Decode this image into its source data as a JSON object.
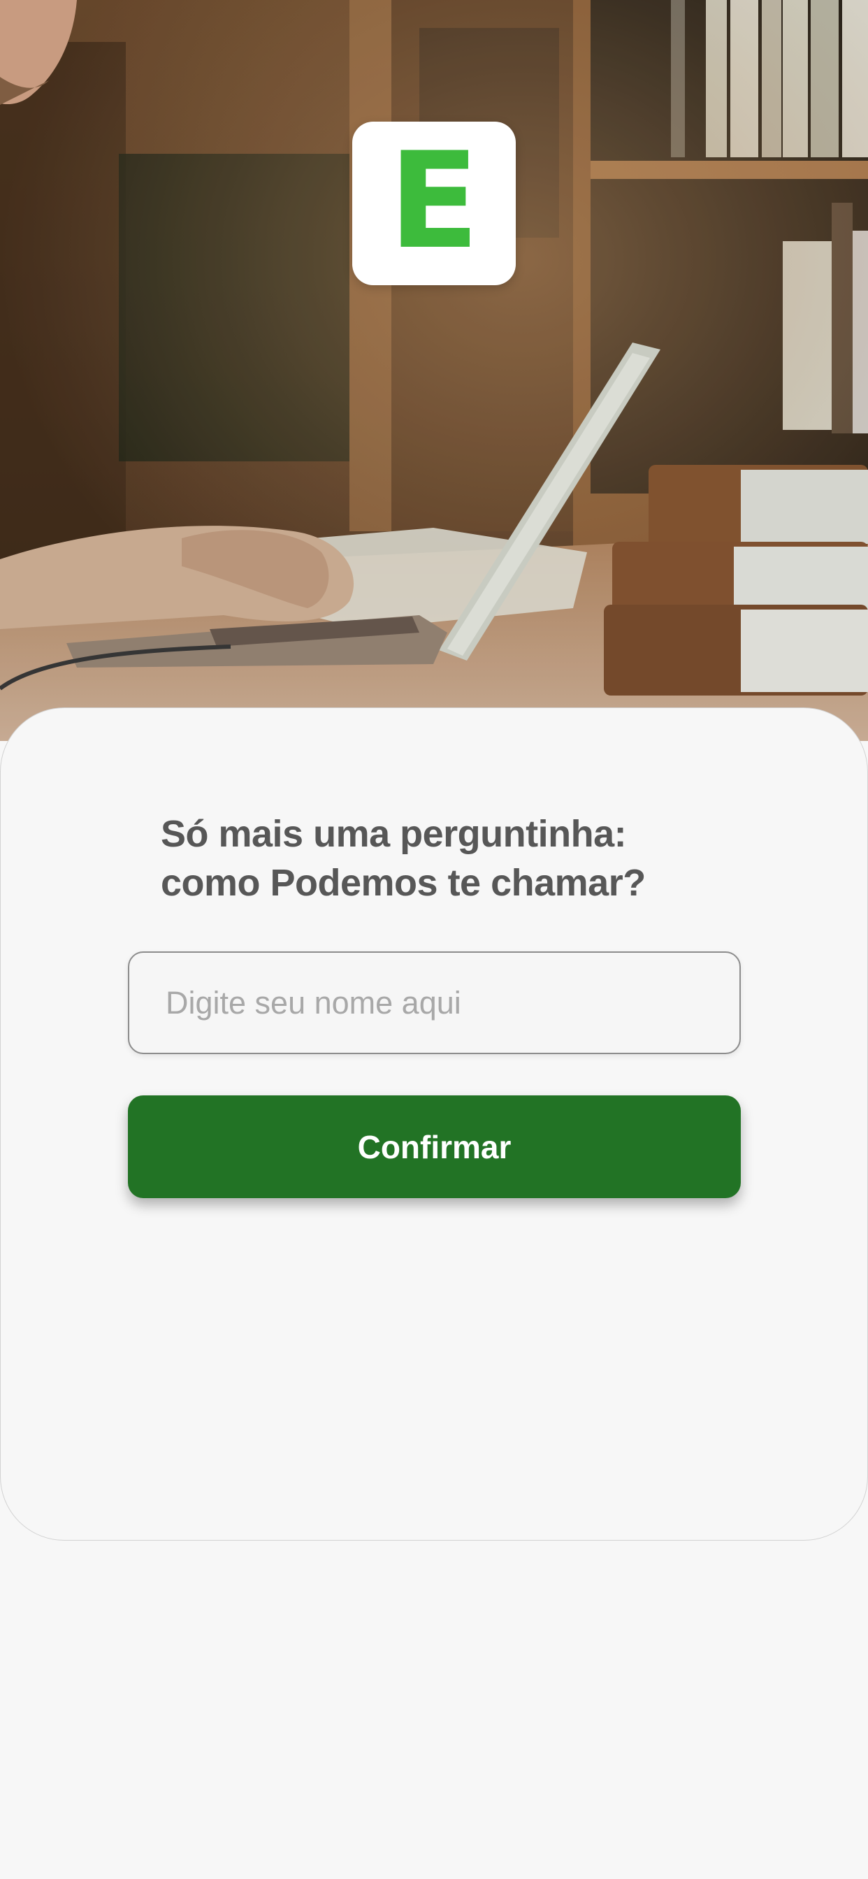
{
  "hero": {
    "logo_letter": "E",
    "photo_alt": "Pessoa digitando em um notebook em uma biblioteca"
  },
  "form": {
    "question": "Só mais uma perguntinha: como Podemos te chamar?",
    "name_placeholder": "Digite seu nome aqui",
    "name_value": "",
    "confirm_label": "Confirmar"
  },
  "colors": {
    "brand_green": "#3dbb3c",
    "button_green": "#227325",
    "background": "#f7f7f7",
    "text": "#575757",
    "placeholder": "#a8a8a8"
  }
}
